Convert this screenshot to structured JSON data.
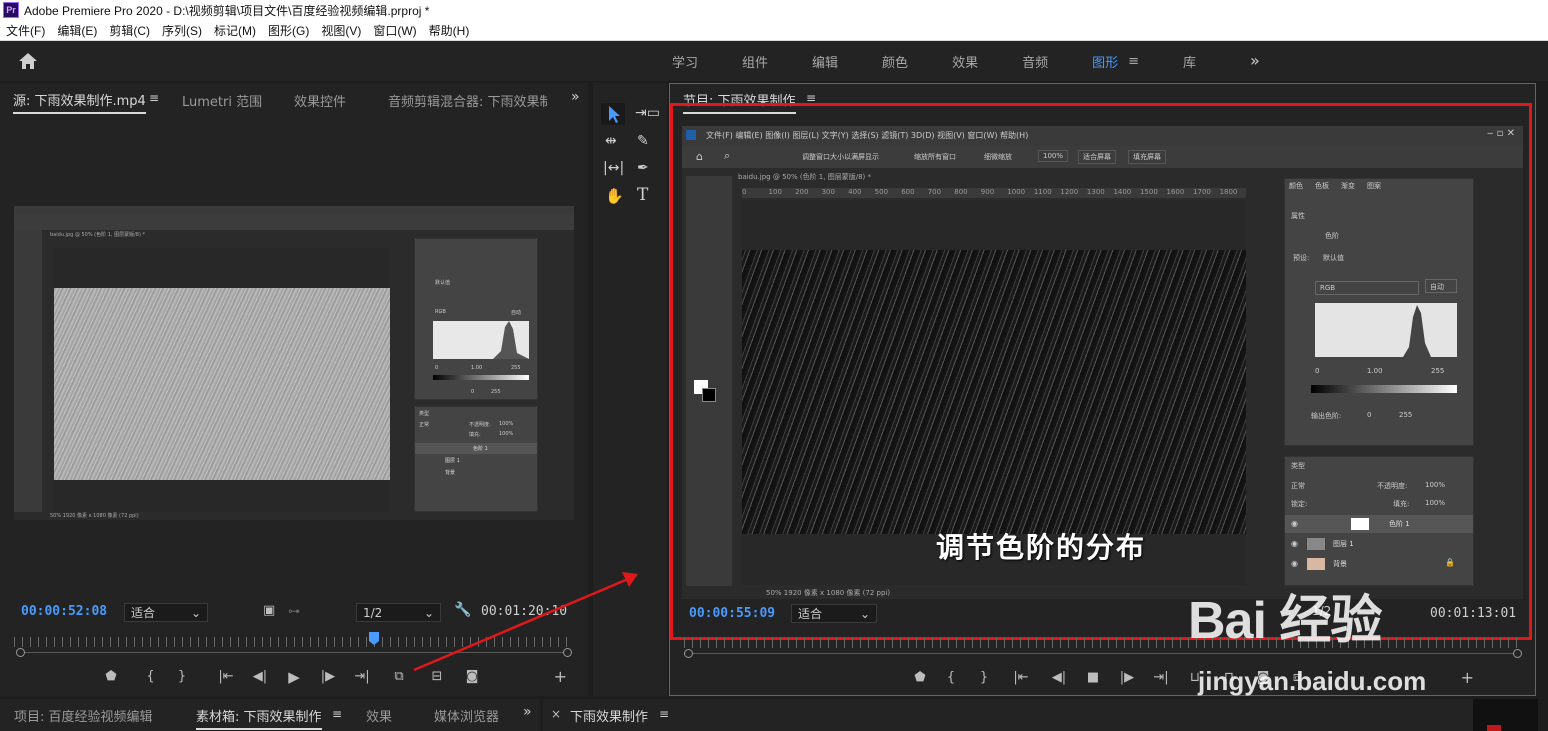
{
  "app": {
    "title": "Adobe Premiere Pro 2020 - D:\\视频剪辑\\项目文件\\百度经验视频编辑.prproj *",
    "logo": "Pr"
  },
  "menu": [
    "文件(F)",
    "编辑(E)",
    "剪辑(C)",
    "序列(S)",
    "标记(M)",
    "图形(G)",
    "视图(V)",
    "窗口(W)",
    "帮助(H)"
  ],
  "workspaces": {
    "tabs": [
      "学习",
      "组件",
      "编辑",
      "颜色",
      "效果",
      "音频",
      "图形",
      "库"
    ],
    "active": "图形",
    "more": "»"
  },
  "source": {
    "tabs": [
      "源: 下雨效果制作.mp4",
      "Lumetri 范围",
      "效果控件",
      "音频剪辑混合器: 下雨效果制"
    ],
    "menu_icon": "≡",
    "more": "»",
    "timecode_current": "00:00:52:08",
    "fit": "适合",
    "resolution": "1/2",
    "timecode_duration": "00:01:20:10"
  },
  "program": {
    "tab": "节目: 下雨效果制作",
    "menu_icon": "≡",
    "timecode_current": "00:00:55:09",
    "fit": "适合",
    "resolution": "1/2",
    "timecode_duration": "00:01:13:01",
    "caption": "调节色阶的分布"
  },
  "photoshop_small": {
    "doc_tab": "baidu.jpg @ 50% (色阶 1, 图层蒙版/8) *",
    "status": "50%   1920 像素 x 1080 像素 (72 ppi)",
    "panel_tabs": [
      "颜色",
      "色板",
      "渐变",
      "图案"
    ],
    "levels_values": [
      "0",
      "1.00",
      "255"
    ],
    "output_values": [
      "0",
      "255"
    ],
    "preset": "默认值",
    "channel": "RGB",
    "auto": "自动",
    "layers": [
      "色阶 1",
      "图层 1",
      "背景"
    ],
    "blend": "正常",
    "opacity_label": "不透明度:",
    "opacity": "100%",
    "fill_label": "填充:",
    "fill": "100%",
    "kind": "类型"
  },
  "photoshop_large": {
    "menu": [
      "文件(F)",
      "编辑(E)",
      "图像(I)",
      "图层(L)",
      "文字(Y)",
      "选择(S)",
      "滤镜(T)",
      "3D(D)",
      "视图(V)",
      "窗口(W)",
      "帮助(H)"
    ],
    "opt_check1": "调整窗口大小以满屏显示",
    "opt_check2": "缩放所有窗口",
    "opt_check3": "细微缩放",
    "zoom": "100%",
    "fit_screen": "适合屏幕",
    "fill_screen": "填充屏幕",
    "doc_tab": "baidu.jpg @ 50% (色阶 1, 图层蒙版/8) *",
    "ruler": [
      "0",
      "100",
      "200",
      "300",
      "400",
      "500",
      "600",
      "700",
      "800",
      "900",
      "1000",
      "1100",
      "1200",
      "1300",
      "1400",
      "1500",
      "1600",
      "1700",
      "1800"
    ],
    "status": "50%   1920 像素 x 1080 像素 (72 ppi)",
    "panel_tabs": [
      "颜色",
      "色板",
      "渐变",
      "图案"
    ],
    "props_label": "属性",
    "levels_label": "色阶",
    "preset_label": "预设:",
    "preset": "默认值",
    "channel": "RGB",
    "auto": "自动",
    "levels_values": [
      "0",
      "1.00",
      "255"
    ],
    "output_label": "输出色阶:",
    "output_values": [
      "0",
      "255"
    ],
    "kind": "类型",
    "blend": "正常",
    "opacity_label": "不透明度:",
    "opacity": "100%",
    "lock_label": "锁定:",
    "fill_label": "填充:",
    "fill": "100%",
    "layers": [
      "色阶 1",
      "图层 1",
      "背景"
    ]
  },
  "bottom_left": {
    "tabs": [
      "项目: 百度经验视频编辑",
      "素材箱: 下雨效果制作",
      "效果",
      "媒体浏览器"
    ],
    "menu_icon": "≡",
    "more": "»"
  },
  "bottom_right": {
    "close": "×",
    "tab": "下雨效果制作",
    "menu_icon": "≡"
  },
  "watermark": {
    "logo": "Bai 经验",
    "url": "jingyan.baidu.com"
  },
  "colors": {
    "accent_blue": "#4a9bff",
    "highlight_red": "#e0181b",
    "panel_bg": "#232323"
  }
}
